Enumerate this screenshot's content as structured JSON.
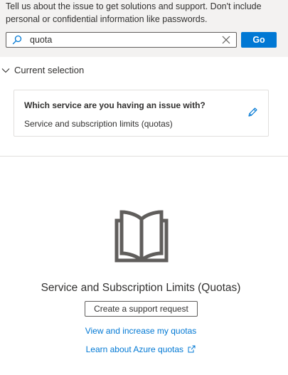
{
  "intro": {
    "text": "Tell us about the issue to get solutions and support. Don't include personal or confidential information like passwords."
  },
  "search": {
    "value": "quota",
    "icon": "search-icon",
    "clear_icon": "close-icon",
    "go_label": "Go"
  },
  "current_selection": {
    "title": "Current selection",
    "question": "Which service are you having an issue with?",
    "answer": "Service and subscription limits (quotas)",
    "edit_icon": "pencil-icon"
  },
  "result": {
    "icon": "book-icon",
    "title": "Service and Subscription Limits (Quotas)",
    "support_button": "Create a support request",
    "links": [
      "View and increase my quotas",
      "Learn about Azure quotas"
    ]
  },
  "colors": {
    "accent": "#0078d4",
    "panel_bg": "#f3f2f1",
    "text": "#323130",
    "border": "#e1dfdd"
  }
}
